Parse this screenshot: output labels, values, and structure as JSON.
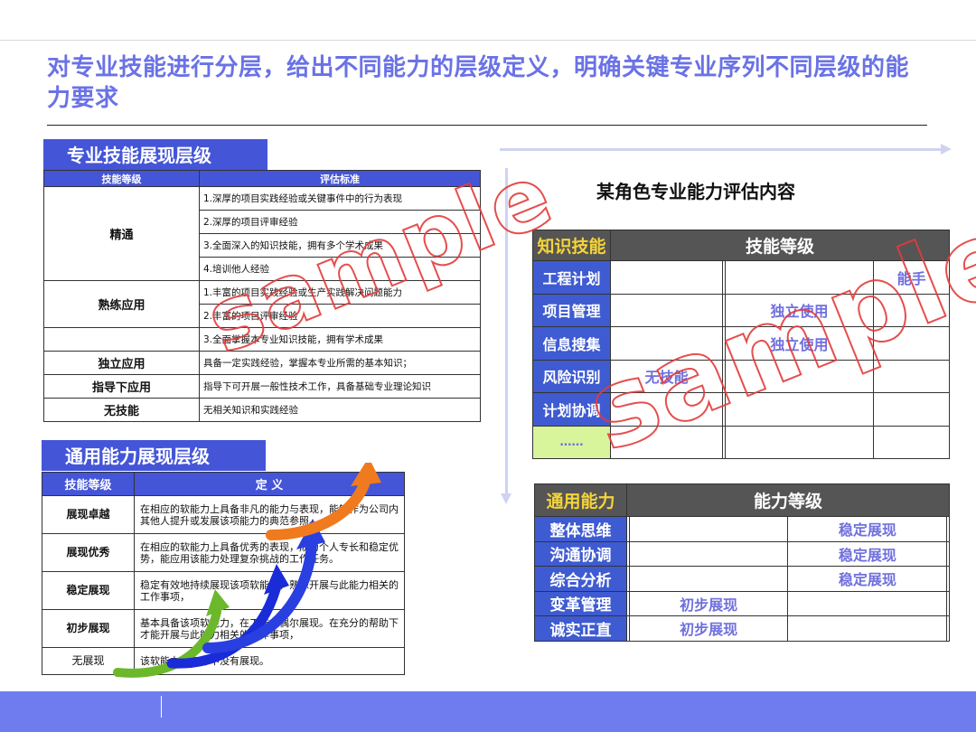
{
  "page": {
    "title": "对专业技能进行分层，给出不同能力的层级定义，明确关键专业序列不同层级的能力要求"
  },
  "skill_section": {
    "tab": "专业技能展现层级",
    "headers": [
      "技能等级",
      "评估标准"
    ],
    "levels": {
      "jingtong": "精通",
      "shulian": "熟练应用",
      "duli": "独立应用",
      "zhidao": "指导下应用",
      "wu": "无技能"
    },
    "criteria": [
      "1.深厚的项目实践经验或关键事件中的行为表现",
      "2.深厚的项目评审经验",
      "3.全面深入的知识技能，拥有多个学术成果",
      "4.培训他人经验",
      "1.丰富的项目实践经验或生产实践解决问题能力",
      "2.丰富的项目评审经验",
      "3.全面掌握本专业知识技能，拥有学术成果",
      "具备一定实践经验，掌握本专业所需的基本知识；",
      "指导下可开展一般性技术工作，具备基础专业理论知识",
      "无相关知识和实践经验"
    ]
  },
  "general_section": {
    "tab": "通用能力展现层级",
    "headers": [
      "技能等级",
      "定  义"
    ],
    "rows": [
      {
        "level": "展现卓越",
        "definition": "在相应的软能力上具备非凡的能力与表现，能够作为公司内其他人提升或发展该项能力的典范参照。"
      },
      {
        "level": "展现优秀",
        "definition": "在相应的软能力上具备优秀的表现，成为个人专长和稳定优势，能应用该能力处理复杂挑战的工作任务。"
      },
      {
        "level": "稳定展现",
        "definition": "稳定有效地持续展现该项软能力，熟练开展与此能力相关的工作事项，"
      },
      {
        "level": "初步展现",
        "definition": "基本具备该项软能力，在工作中偶尔展现。在充分的帮助下才能开展与此能力相关的工作事项，"
      },
      {
        "level": "无展现",
        "definition": "该软能力在工作中没有展现。"
      }
    ]
  },
  "role_eval": {
    "title": "某角色专业能力评估内容",
    "knowledge": {
      "corner": "知识技能",
      "header": "技能等级",
      "rows": [
        {
          "name": "工程计划",
          "cells": [
            "",
            "",
            "",
            "能手"
          ]
        },
        {
          "name": "项目管理",
          "cells": [
            "",
            "",
            "独立使用",
            ""
          ]
        },
        {
          "name": "信息搜集",
          "cells": [
            "",
            "",
            "独立使用",
            ""
          ]
        },
        {
          "name": "风险识别",
          "cells": [
            "无技能",
            "",
            "",
            ""
          ]
        },
        {
          "name": "计划协调",
          "cells": [
            "",
            "",
            "",
            ""
          ]
        },
        {
          "name": "……",
          "cells": [
            "",
            "",
            "",
            ""
          ]
        }
      ]
    },
    "general": {
      "corner": "通用能力",
      "header": "能力等级",
      "rows": [
        {
          "name": "整体思维",
          "cells": [
            "",
            "",
            "稳定展现",
            ""
          ]
        },
        {
          "name": "沟通协调",
          "cells": [
            "",
            "",
            "稳定展现",
            ""
          ]
        },
        {
          "name": "综合分析",
          "cells": [
            "",
            "",
            "稳定展现",
            ""
          ]
        },
        {
          "name": "变革管理",
          "cells": [
            "",
            "初步展现",
            "",
            ""
          ]
        },
        {
          "name": "诚实正直",
          "cells": [
            "",
            "初步展现",
            "",
            ""
          ]
        }
      ]
    }
  },
  "watermark": "sample",
  "colors": {
    "title": "#6a72e6",
    "tab_bg": "#4455d8",
    "table_header_dark": "#555555",
    "row_header_blue": "#3f5bd1",
    "dots_green": "#d9f59b",
    "cell_text": "#7070dd",
    "footer": "#6f7cf0",
    "watermark": "#e43b3b"
  }
}
